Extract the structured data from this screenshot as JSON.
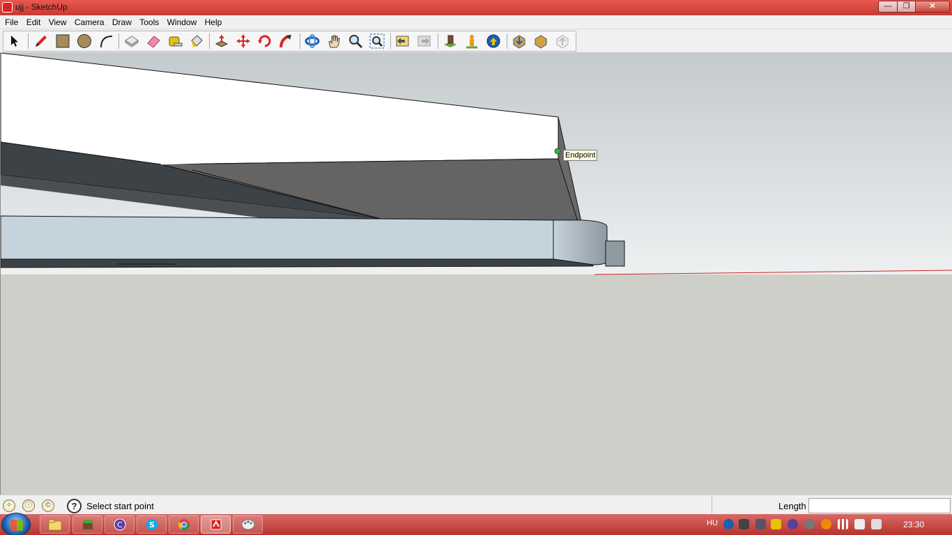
{
  "window": {
    "title": "ujj - SketchUp",
    "min_glyph": "—",
    "max_glyph": "❐",
    "close_glyph": "✕"
  },
  "menu": [
    "File",
    "Edit",
    "View",
    "Camera",
    "Draw",
    "Tools",
    "Window",
    "Help"
  ],
  "toolbar": {
    "tools": [
      {
        "name": "select-tool",
        "icon": "arrow-icon"
      },
      {
        "name": "line-tool",
        "icon": "pencil-icon"
      },
      {
        "name": "rectangle-tool",
        "icon": "rectangle-icon"
      },
      {
        "name": "circle-tool",
        "icon": "circle-icon"
      },
      {
        "name": "arc-tool",
        "icon": "arc-icon"
      },
      {
        "name": "make-component-tool",
        "icon": "component-icon"
      },
      {
        "name": "eraser-tool",
        "icon": "eraser-icon"
      },
      {
        "name": "tape-measure-tool",
        "icon": "tape-measure-icon"
      },
      {
        "name": "paint-bucket-tool",
        "icon": "paint-bucket-icon"
      },
      {
        "name": "push-pull-tool",
        "icon": "push-pull-icon"
      },
      {
        "name": "move-tool",
        "icon": "move-icon"
      },
      {
        "name": "rotate-tool",
        "icon": "rotate-icon"
      },
      {
        "name": "follow-me-tool",
        "icon": "follow-me-icon"
      },
      {
        "name": "orbit-tool",
        "icon": "orbit-icon"
      },
      {
        "name": "pan-tool",
        "icon": "hand-icon"
      },
      {
        "name": "zoom-tool",
        "icon": "zoom-icon"
      },
      {
        "name": "zoom-extents-tool",
        "icon": "zoom-extents-icon"
      },
      {
        "name": "previous-view-tool",
        "icon": "previous-view-icon"
      },
      {
        "name": "next-view-tool",
        "icon": "next-view-icon"
      },
      {
        "name": "add-location-tool",
        "icon": "location-icon"
      },
      {
        "name": "position-camera-tool",
        "icon": "position-camera-icon"
      },
      {
        "name": "google-earth-tool",
        "icon": "globe-icon"
      },
      {
        "name": "get-models-tool",
        "icon": "get-models-icon"
      },
      {
        "name": "share-model-tool",
        "icon": "share-model-icon"
      },
      {
        "name": "share-component-tool",
        "icon": "share-component-icon"
      }
    ]
  },
  "viewport": {
    "inference_tooltip": "Endpoint",
    "colors": {
      "sky": "#ffffff",
      "ground": "#cfcfc9",
      "slab_top": "#ffffff",
      "slab_dark": "#3d4246",
      "slab_mid": "#646464",
      "beam": "#c5d3dc",
      "axis_red": "#cc2222",
      "endpoint": "#3cb043"
    }
  },
  "status": {
    "message": "Select start point",
    "vcb_label": "Length",
    "vcb_value": "",
    "help_glyph": "?"
  },
  "taskbar": {
    "language": "HU",
    "clock": "23:30",
    "apps": [
      "explorer",
      "minecraft",
      "app-c",
      "skype",
      "chrome",
      "sketchup",
      "paint"
    ]
  }
}
